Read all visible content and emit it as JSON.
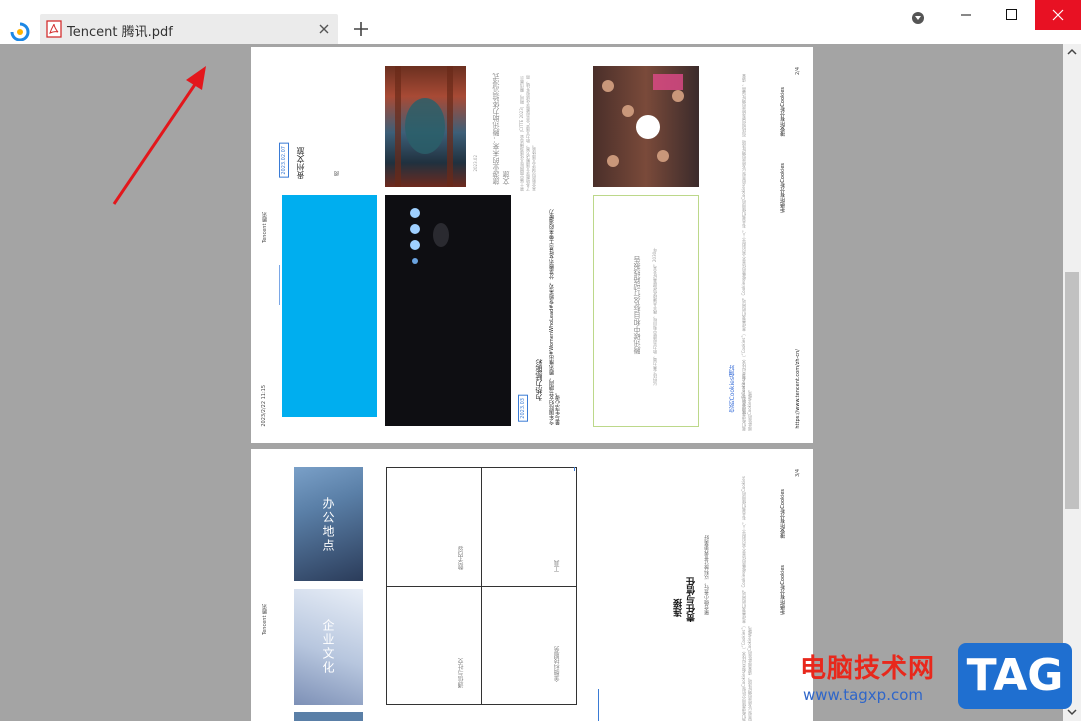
{
  "tab": {
    "title": "Tencent 腾讯.pdf"
  },
  "page1": {
    "running_header": "Tencent 腾讯",
    "date_footer": "2023/2/22 11:15",
    "page_num": "2/4",
    "art1": {
      "date": "2023.02.07",
      "title": "贵州文旅",
      "meta": "阅"
    },
    "art2": {
      "date": "2023.02",
      "title": "旅游业的未来：腾讯助力体验沉浸式文旅",
      "body": "第十届中国国际文化旅游博览会（CITTE 2023）期间，腾讯展示了多项数字文旅解决方案，助力文旅产业实现数字化转型升级，带来全新的沉浸式文旅体验。"
    },
    "art3": {
      "date": "2023.03",
      "title": "为热力赋能彩",
      "body": "今年国际妇女节期间，腾讯推出#WomenWhoLead#专题采访，分享腾讯女性员工带来的温暖力量与生活心得。"
    },
    "card": {
      "title": "腾讯碳中和目标及行动路线报告",
      "body": "以科技之善力量，助力实现碳中和目标，携手共建绿色低碳美好未来。2030年"
    },
    "cookies": {
      "title": "您的Cookies偏好",
      "intro": "欢迎来到Tencent.com",
      "body": "我们希望使用分析型Cookies和类似技术（“Cookies”）来改善我们的网站。Cookies收集的信息不会识别您个人。有关我们使用的Cookies的类型以及您的偏好选项（包括如何更改您的偏好设置），请查阅此处的Cookies政策。",
      "link_accept": "接受所有分析Cookies",
      "link_reject": "拒绝所有分析Cookies"
    },
    "url": "https://www.tencent.com/zh-cn/"
  },
  "page2": {
    "running_header": "Tencent 腾讯",
    "page_num": "3/4",
    "photo1": "办公地点",
    "photo2": "企业文化",
    "grid": [
      "数字内容",
      "工具",
      "通信与社交",
      "金融科技服务"
    ],
    "hero": {
      "line1": "连接",
      "line2": "责任与信任",
      "sub": "聚合微小善行，以科技让世界更美好"
    },
    "cookies_body": "我们希望使用分析型Cookies和类似技术（“Cookies”）来改善我们的网站。Cookies收集的信息不会识别您个人。有关我们使用的Cookies的类型以及您的偏好选项，请查阅此处的Cookies政策。",
    "link_accept": "接受所有分析Cookies",
    "link_reject": "拒绝所有分析Cookies"
  },
  "watermark": {
    "cn": "电脑技术网",
    "url": "www.tagxp.com",
    "tag": "TAG"
  },
  "colors": {
    "accent": "#00aeef",
    "arrow": "#e3171c",
    "viewer_bg": "#a4a4a4"
  }
}
